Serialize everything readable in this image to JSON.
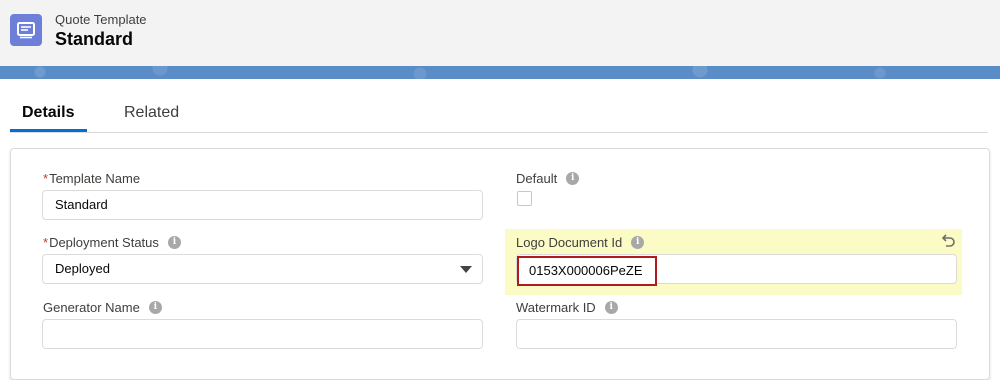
{
  "header": {
    "object_label": "Quote Template",
    "record_title": "Standard",
    "icon": "quote-template-icon"
  },
  "tabs": [
    {
      "label": "Details",
      "active": true
    },
    {
      "label": "Related",
      "active": false
    }
  ],
  "fields": {
    "template_name": {
      "label": "Template Name",
      "required": true,
      "value": "Standard"
    },
    "default": {
      "label": "Default",
      "checked": false
    },
    "deployment_status": {
      "label": "Deployment Status",
      "required": true,
      "value": "Deployed"
    },
    "logo_document_id": {
      "label": "Logo Document Id",
      "value": "0153X000006PeZE"
    },
    "generator_name": {
      "label": "Generator Name",
      "value": ""
    },
    "watermark_id": {
      "label": "Watermark ID",
      "value": ""
    }
  },
  "colors": {
    "accent": "#0070d2",
    "banner": "#5a8dc7",
    "app_icon": "#6d7fd9",
    "highlight": "#fbfbc5",
    "annotation_border": "#b01c1c"
  }
}
